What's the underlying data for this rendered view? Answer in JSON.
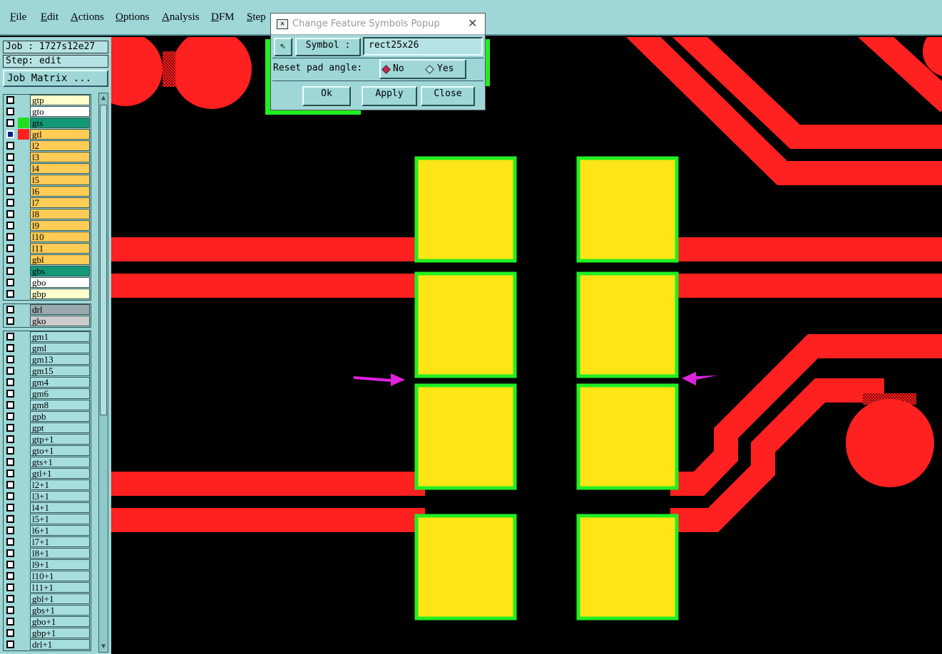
{
  "menubar": {
    "items": [
      "File",
      "Edit",
      "Actions",
      "Options",
      "Analysis",
      "DFM",
      "Step"
    ]
  },
  "sidebar": {
    "job": "Job : 1727s12e27",
    "step": "Step: edit",
    "job_matrix": "Job Matrix ...",
    "groups": [
      {
        "layers": [
          {
            "name": "gtp",
            "color": "#ffffcc"
          },
          {
            "name": "gto",
            "color": "#ffffff"
          },
          {
            "name": "gts",
            "color": "#119977",
            "selected_color": "#22dd22"
          },
          {
            "name": "gtl",
            "color": "#ffcc55",
            "selected_color": "#ff2020",
            "active": true
          },
          {
            "name": "l2",
            "color": "#ffcc55"
          },
          {
            "name": "l3",
            "color": "#ffcc55"
          },
          {
            "name": "l4",
            "color": "#ffcc55"
          },
          {
            "name": "l5",
            "color": "#ffcc55"
          },
          {
            "name": "l6",
            "color": "#ffcc55"
          },
          {
            "name": "l7",
            "color": "#ffcc55"
          },
          {
            "name": "l8",
            "color": "#ffcc55"
          },
          {
            "name": "l9",
            "color": "#ffcc55"
          },
          {
            "name": "l10",
            "color": "#ffcc55"
          },
          {
            "name": "l11",
            "color": "#ffcc55"
          },
          {
            "name": "gbl",
            "color": "#ffcc55"
          },
          {
            "name": "gbs",
            "color": "#119977"
          },
          {
            "name": "gbo",
            "color": "#ffffff"
          },
          {
            "name": "gbp",
            "color": "#ffffcc"
          }
        ]
      },
      {
        "layers": [
          {
            "name": "drl",
            "color": "#9aa8b0"
          },
          {
            "name": "gko",
            "color": "#cccccc"
          }
        ]
      },
      {
        "layers": [
          {
            "name": "gm1",
            "color": "#a6dede"
          },
          {
            "name": "gml",
            "color": "#a6dede"
          },
          {
            "name": "gm13",
            "color": "#a6dede"
          },
          {
            "name": "gm15",
            "color": "#a6dede"
          },
          {
            "name": "gm4",
            "color": "#a6dede"
          },
          {
            "name": "gm6",
            "color": "#a6dede"
          },
          {
            "name": "gm8",
            "color": "#a6dede"
          },
          {
            "name": "gpb",
            "color": "#a6dede"
          },
          {
            "name": "gpt",
            "color": "#a6dede"
          },
          {
            "name": "gtp+1",
            "color": "#a6dede"
          },
          {
            "name": "gto+1",
            "color": "#a6dede"
          },
          {
            "name": "gts+1",
            "color": "#a6dede"
          },
          {
            "name": "gtl+1",
            "color": "#a6dede"
          },
          {
            "name": "l2+1",
            "color": "#a6dede"
          },
          {
            "name": "l3+1",
            "color": "#a6dede"
          },
          {
            "name": "l4+1",
            "color": "#a6dede"
          },
          {
            "name": "l5+1",
            "color": "#a6dede"
          },
          {
            "name": "l6+1",
            "color": "#a6dede"
          },
          {
            "name": "l7+1",
            "color": "#a6dede"
          },
          {
            "name": "l8+1",
            "color": "#a6dede"
          },
          {
            "name": "l9+1",
            "color": "#a6dede"
          },
          {
            "name": "l10+1",
            "color": "#a6dede"
          },
          {
            "name": "l11+1",
            "color": "#a6dede"
          },
          {
            "name": "gbl+1",
            "color": "#a6dede"
          },
          {
            "name": "gbs+1",
            "color": "#a6dede"
          },
          {
            "name": "gbo+1",
            "color": "#a6dede"
          },
          {
            "name": "gbp+1",
            "color": "#a6dede"
          },
          {
            "name": "drl+1",
            "color": "#a6dede"
          }
        ]
      }
    ]
  },
  "dialog": {
    "title": "Change Feature Symbols Popup",
    "symbol_label": "Symbol :",
    "symbol_value": "rect25x26",
    "reset_label": "Reset pad angle:",
    "option_no": "No",
    "option_yes": "Yes",
    "selected_option": "No",
    "ok": "Ok",
    "apply": "Apply",
    "close": "Close"
  },
  "colors": {
    "trace": "#ff2020",
    "pad": "#ffe516",
    "mask": "#22ee22",
    "arrow": "#dd22dd",
    "ui": "#9fd7d7"
  }
}
